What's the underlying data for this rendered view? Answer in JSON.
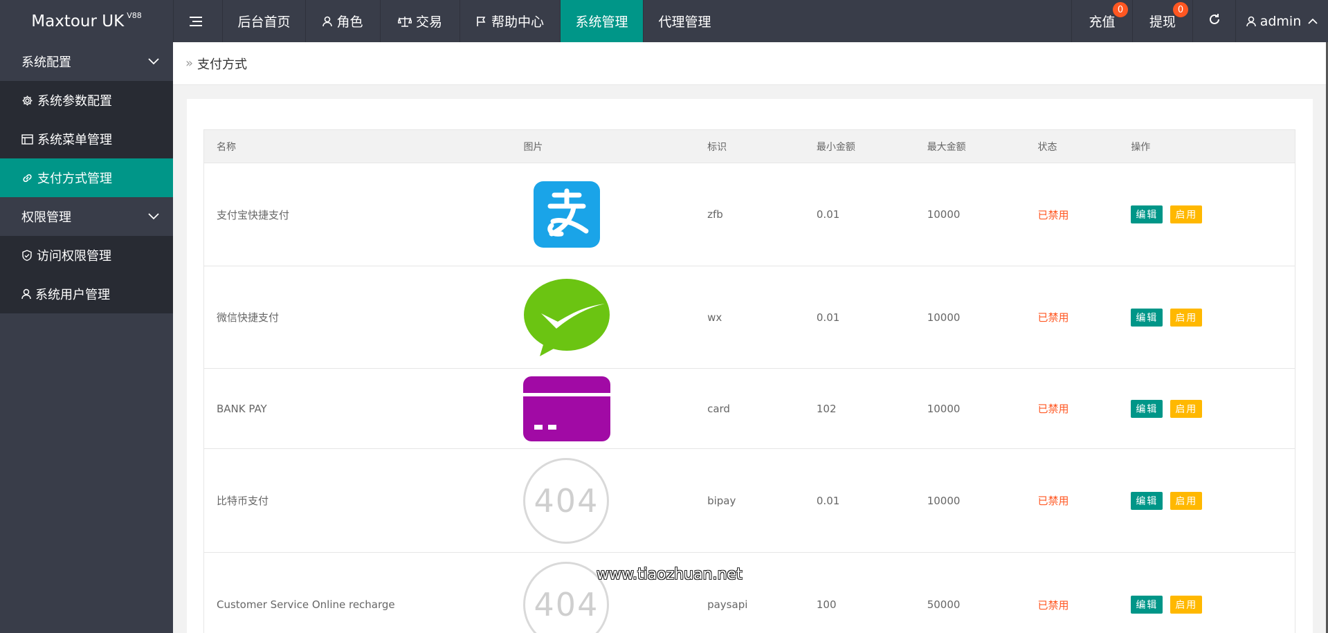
{
  "header": {
    "logo": "Maxtour UK",
    "logo_version": "V88",
    "nav": [
      "后台首页",
      "角色",
      "交易",
      "帮助中心",
      "系统管理",
      "代理管理"
    ],
    "recharge": {
      "label": "充值",
      "badge": "0"
    },
    "withdraw": {
      "label": "提现",
      "badge": "0"
    },
    "user": "admin"
  },
  "sidebar": {
    "group1": "系统配置",
    "items1": [
      "系统参数配置",
      "系统菜单管理",
      "支付方式管理"
    ],
    "group2": "权限管理",
    "items2": [
      "访问权限管理",
      "系统用户管理"
    ]
  },
  "breadcrumb": "支付方式",
  "table": {
    "headers": [
      "名称",
      "图片",
      "标识",
      "最小金额",
      "最大金额",
      "状态",
      "操作"
    ],
    "rows": [
      {
        "name": "支付宝快捷支付",
        "image": "alipay-logo",
        "code": "zfb",
        "min": "0.01",
        "max": "10000",
        "status": "已禁用",
        "edit": "编辑",
        "enable": "启用"
      },
      {
        "name": "微信快捷支付",
        "image": "wechat-logo",
        "code": "wx",
        "min": "0.01",
        "max": "10000",
        "status": "已禁用",
        "edit": "编辑",
        "enable": "启用"
      },
      {
        "name": "BANK PAY",
        "image": "card-logo",
        "code": "card",
        "min": "102",
        "max": "10000",
        "status": "已禁用",
        "edit": "编辑",
        "enable": "启用"
      },
      {
        "name": "比特币支付",
        "image": "404",
        "code": "bipay",
        "min": "0.01",
        "max": "10000",
        "status": "已禁用",
        "edit": "编辑",
        "enable": "启用"
      },
      {
        "name": "Customer Service Online recharge",
        "image": "404",
        "code": "paysapi",
        "min": "100",
        "max": "50000",
        "status": "已禁用",
        "edit": "编辑",
        "enable": "启用"
      }
    ]
  },
  "watermark": "www.tiaozhuan.net",
  "colors": {
    "header_bg": "#393d49",
    "accent": "#009688",
    "status": "#ff5722",
    "enable_btn": "#ffb800",
    "badge": "#ff5722"
  }
}
